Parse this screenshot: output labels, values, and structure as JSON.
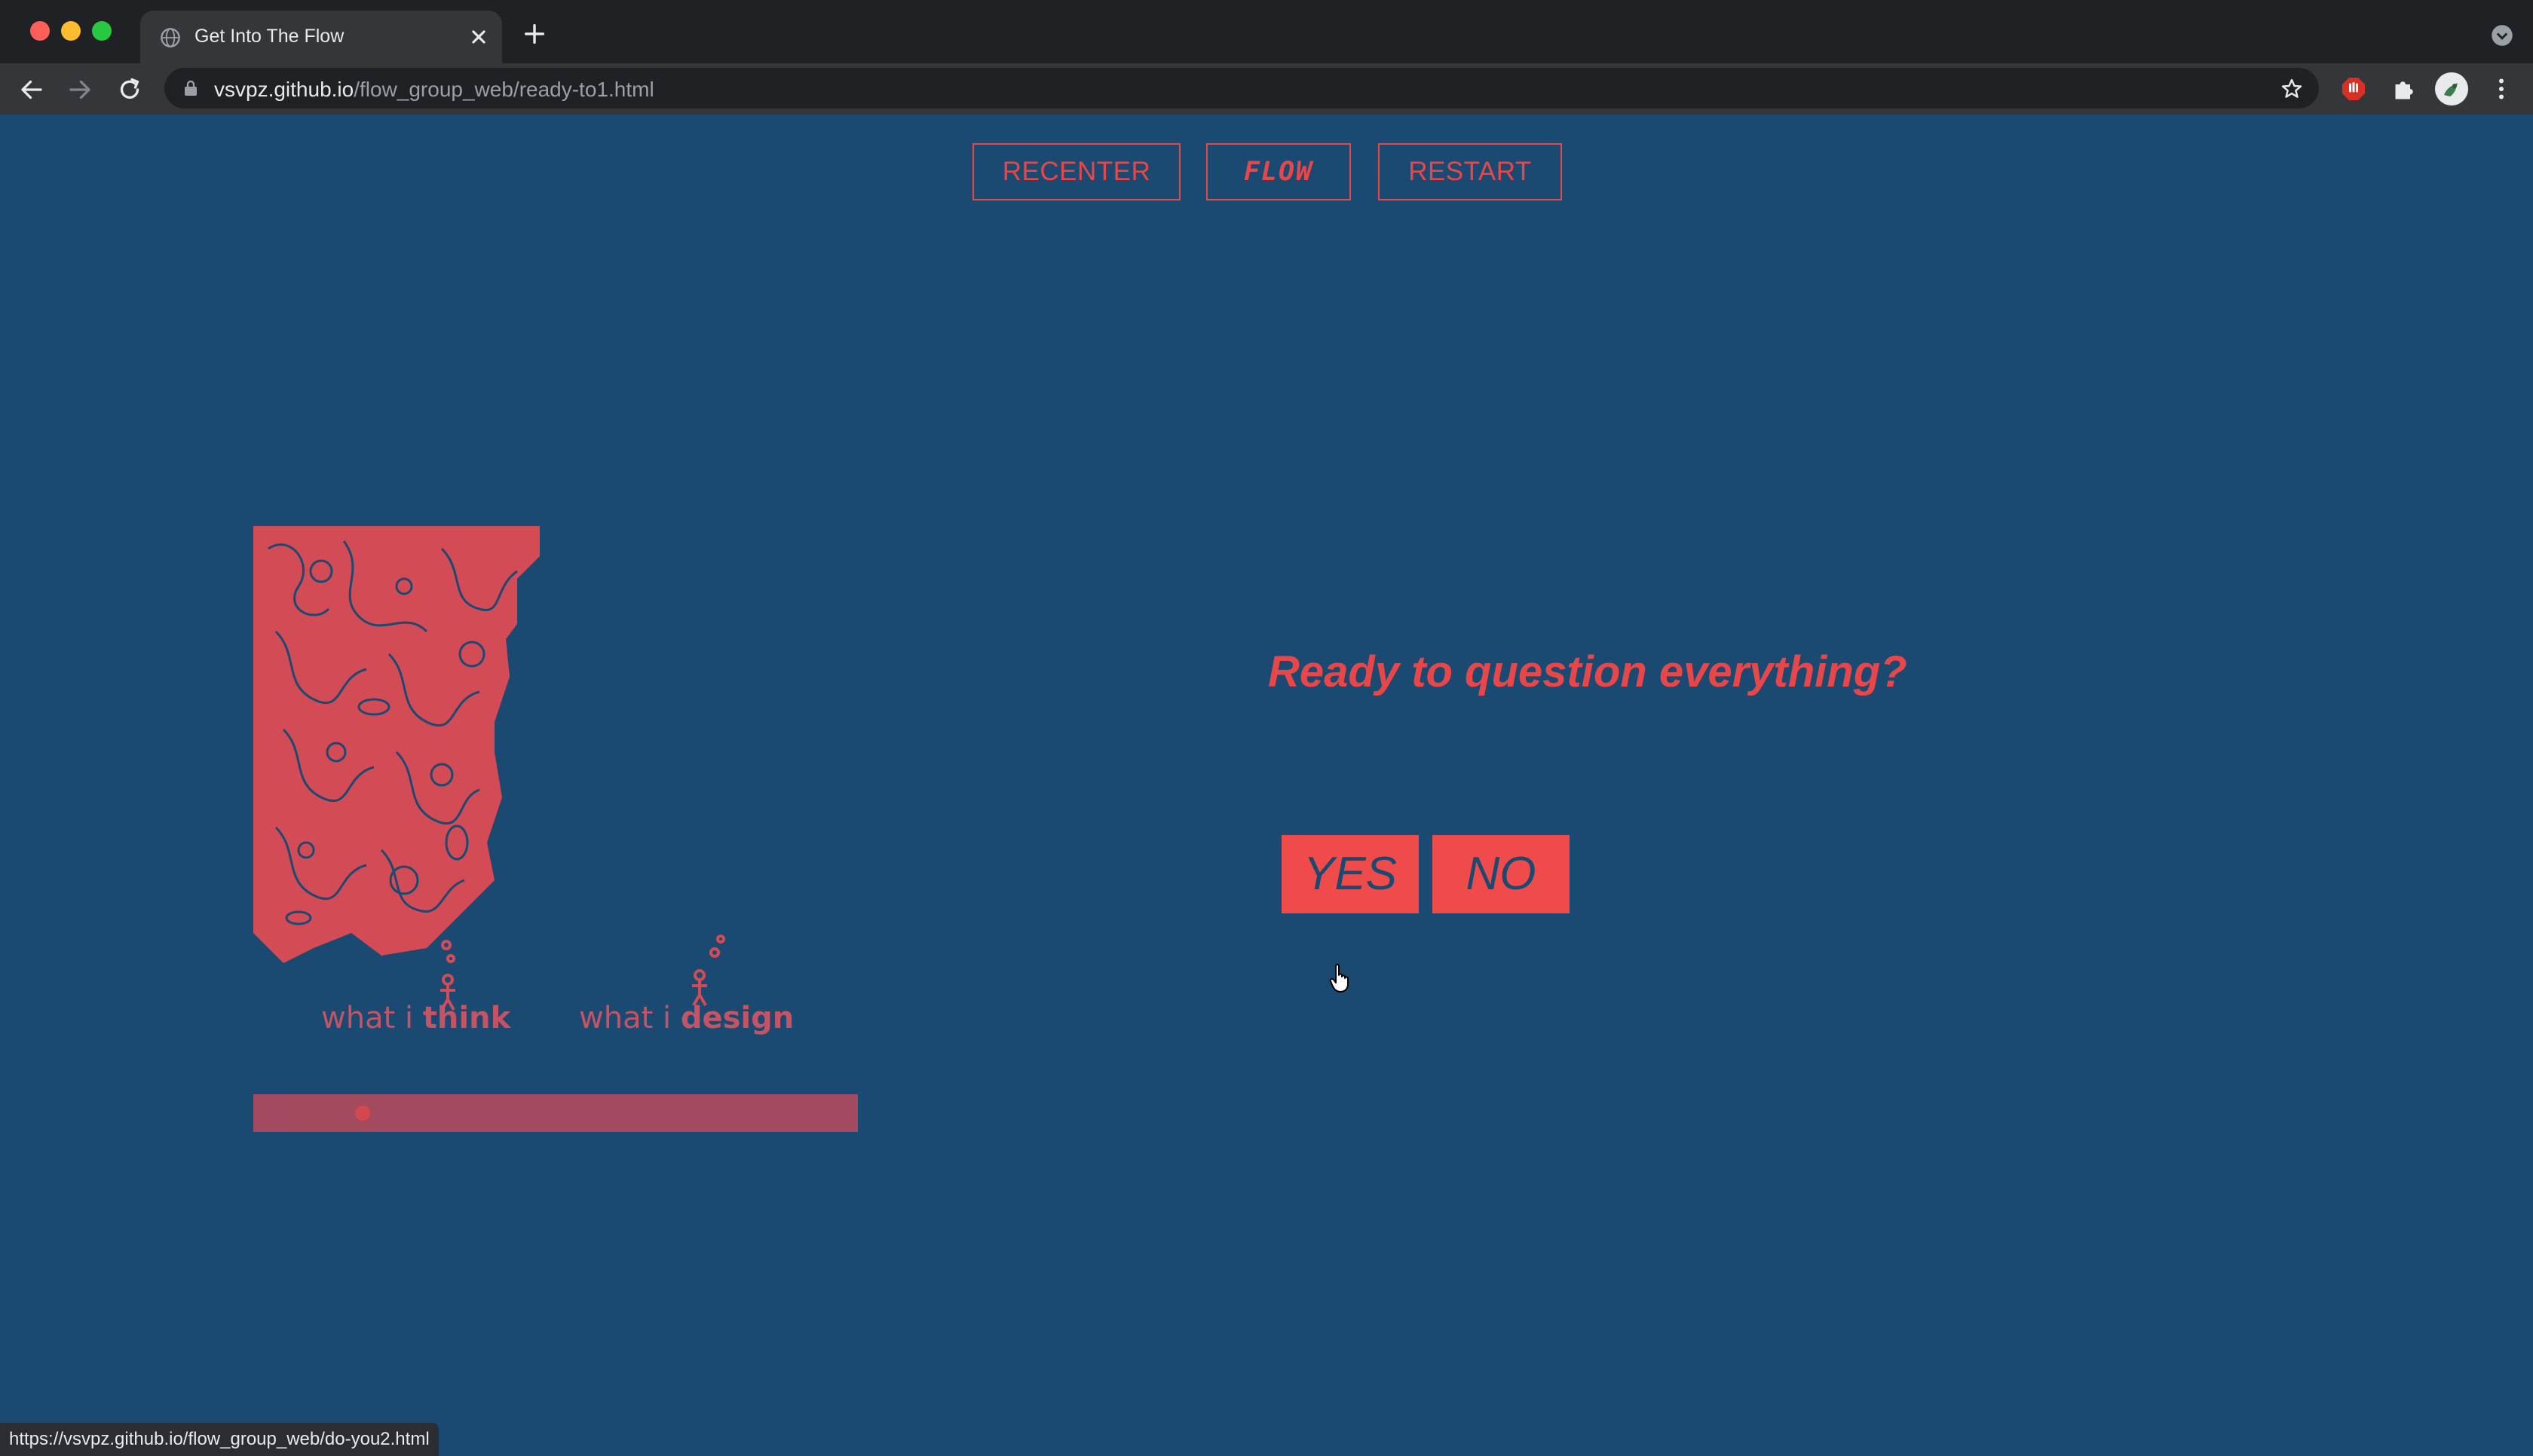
{
  "browser": {
    "tab_title": "Get Into The Flow",
    "url_host": "vsvpz.github.io",
    "url_path": "/flow_group_web/ready-to1.html",
    "status_url": "https://vsvpz.github.io/flow_group_web/do-you2.html"
  },
  "nav": {
    "recenter_label": "RECENTER",
    "flow_label": "FLOW",
    "restart_label": "RESTART"
  },
  "main": {
    "question": "Ready to question everything?",
    "yes_label": "YES",
    "no_label": "NO"
  },
  "artwork": {
    "caption_think_prefix": "what i ",
    "caption_think_word": "think",
    "caption_design_prefix": "what i ",
    "caption_design_word": "design"
  },
  "colors": {
    "page_background": "#1a4a72",
    "accent": "#e8474a",
    "button_fill": "#ef4b4b"
  },
  "icons": [
    "globe-icon",
    "close-icon",
    "plus-icon",
    "back-icon",
    "forward-icon",
    "reload-icon",
    "lock-icon",
    "star-icon",
    "puzzle-icon",
    "menu-icon",
    "pointer-hand-icon"
  ]
}
